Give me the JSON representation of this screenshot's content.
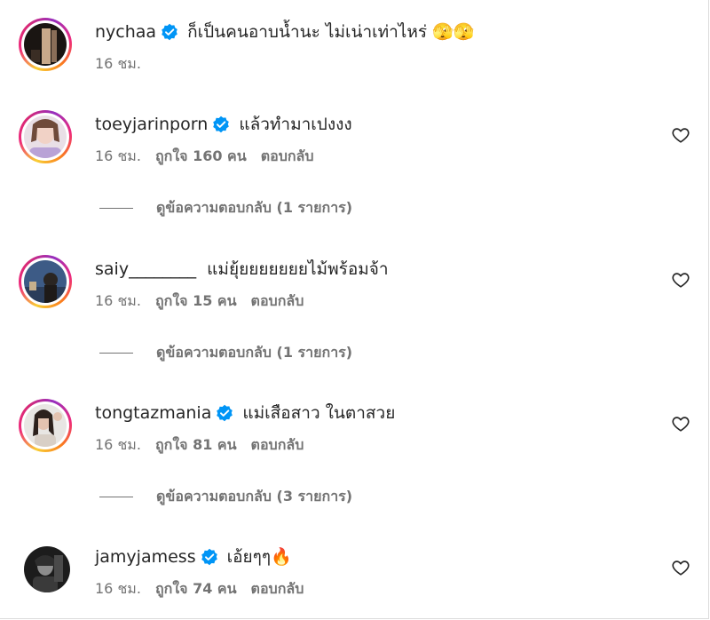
{
  "comments": [
    {
      "username": "nychaa",
      "verified": true,
      "text": "ก็เป็นคนอาบน้ำนะ ไม่เน่าเท่าไหร่ 🫣🫣",
      "time": "16 ชม.",
      "likes": "",
      "reply_label": "",
      "view_replies": "",
      "heart": false,
      "ring": true
    },
    {
      "username": "toeyjarinporn",
      "verified": true,
      "text": "แล้วทำมาเปงงง",
      "time": "16 ชม.",
      "likes": "ถูกใจ 160 คน",
      "reply_label": "ตอบกลับ",
      "view_replies": "ดูข้อความตอบกลับ (1 รายการ)",
      "heart": true,
      "ring": true
    },
    {
      "username": "saiy________",
      "verified": false,
      "text": "แม่ยุ้ยยยยยยยไม้พร้อมจ้า",
      "time": "16 ชม.",
      "likes": "ถูกใจ 15 คน",
      "reply_label": "ตอบกลับ",
      "view_replies": "ดูข้อความตอบกลับ (1 รายการ)",
      "heart": true,
      "ring": true
    },
    {
      "username": "tongtazmania",
      "verified": true,
      "text": "แม่เสือสาว ในตาสวย",
      "time": "16 ชม.",
      "likes": "ถูกใจ 81 คน",
      "reply_label": "ตอบกลับ",
      "view_replies": "ดูข้อความตอบกลับ (3 รายการ)",
      "heart": true,
      "ring": true
    },
    {
      "username": "jamyjamess",
      "verified": true,
      "text": "เอ้ยๆๆ🔥",
      "time": "16 ชม.",
      "likes": "ถูกใจ 74 คน",
      "reply_label": "ตอบกลับ",
      "view_replies": "",
      "heart": true,
      "ring": false
    }
  ],
  "colors": {
    "text": "#262626",
    "secondary": "#737373",
    "verified": "#0095f6"
  }
}
